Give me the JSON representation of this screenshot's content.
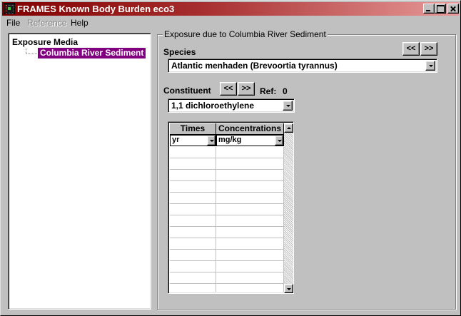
{
  "window": {
    "title": "FRAMES Known Body Burden eco3"
  },
  "menu": {
    "items": [
      {
        "label": "File",
        "enabled": true
      },
      {
        "label": "Reference",
        "enabled": false
      },
      {
        "label": "Help",
        "enabled": true
      }
    ]
  },
  "tree": {
    "root_label": "Exposure Media",
    "child_label": "Columbia River Sediment",
    "selected_color": "#800080"
  },
  "panel": {
    "group_title": "Exposure due to Columbia River Sediment",
    "species_label": "Species",
    "species_value": "Atlantic menhaden (Brevoortia tyrannus)",
    "prev_label": "<<",
    "next_label": ">>",
    "constituent_label": "Constituent",
    "ref_label": "Ref:",
    "ref_value": "0",
    "constituent_value": "1,1 dichloroethylene"
  },
  "grid": {
    "columns": [
      "Times",
      "Concentrations"
    ],
    "units": [
      "yr",
      "mg/kg"
    ],
    "rows": [
      [
        "",
        ""
      ],
      [
        "",
        ""
      ],
      [
        "",
        ""
      ],
      [
        "",
        ""
      ],
      [
        "",
        ""
      ],
      [
        "",
        ""
      ],
      [
        "",
        ""
      ],
      [
        "",
        ""
      ],
      [
        "",
        ""
      ],
      [
        "",
        ""
      ],
      [
        "",
        ""
      ],
      [
        "",
        ""
      ],
      [
        "",
        ""
      ]
    ]
  },
  "colors": {
    "titlebar_start": "#800000",
    "titlebar_end": "#e89a9a",
    "face": "#c0c0c0"
  }
}
